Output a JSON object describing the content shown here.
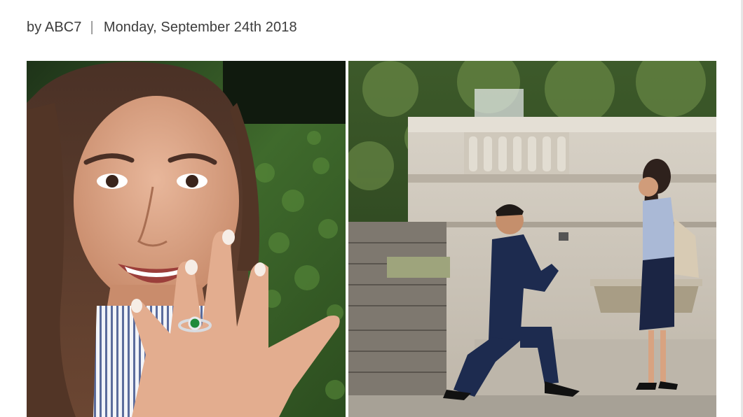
{
  "byline": {
    "author": "by ABC7",
    "separator": "|",
    "date": "Monday, September 24th 2018"
  },
  "photos": [
    {
      "name": "engagement-ring-selfie-photo"
    },
    {
      "name": "marriage-proposal-photo"
    }
  ]
}
